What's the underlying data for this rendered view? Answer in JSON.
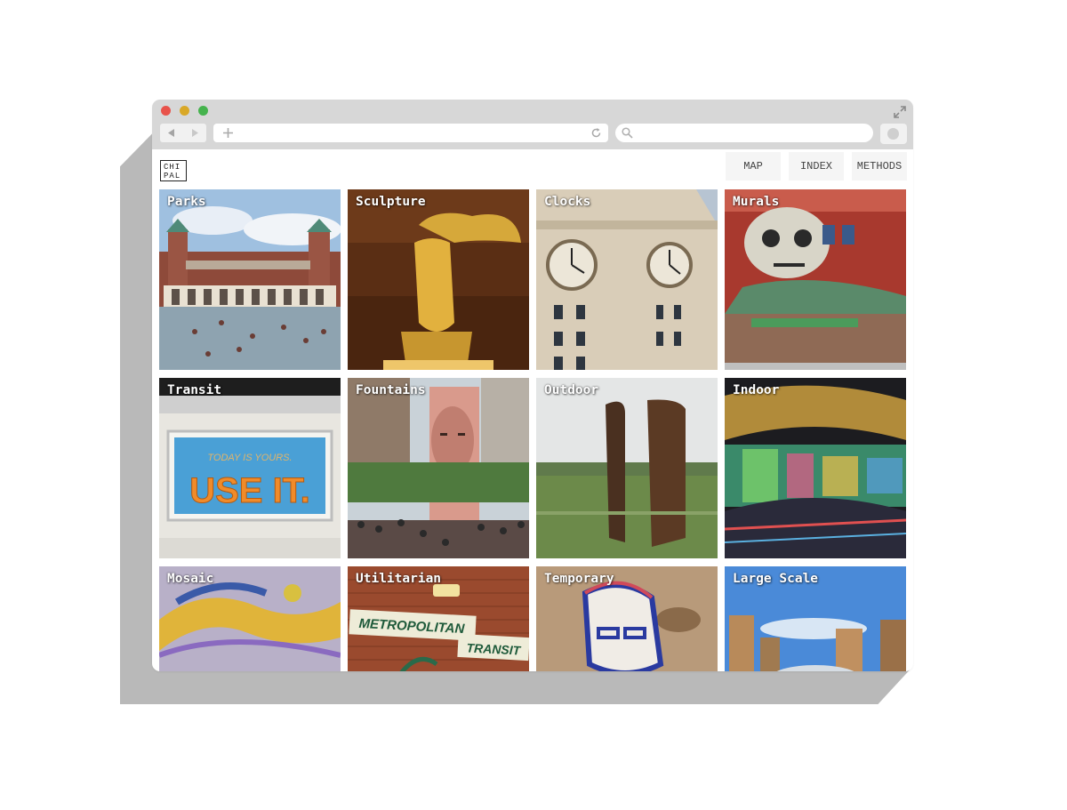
{
  "browser": {
    "url_value": "",
    "search_value": ""
  },
  "site": {
    "logo_line1": "CHI",
    "logo_line2": "PAL",
    "nav": [
      "MAP",
      "INDEX",
      "METHODS"
    ]
  },
  "categories": [
    "Parks",
    "Sculpture",
    "Clocks",
    "Murals",
    "Transit",
    "Fountains",
    "Outdoor",
    "Indoor",
    "Mosaic",
    "Utilitarian",
    "Temporary",
    "Large Scale"
  ],
  "tile_art_text": {
    "transit_line1": "TODAY IS YOURS.",
    "transit_line2": "USE IT.",
    "utilitarian_sign1": "METROPOLITAN",
    "utilitarian_sign2": "TRANSIT"
  },
  "colors": {
    "chrome_bg": "#d7d7d7",
    "close": "#e8524a",
    "minimize": "#d9a827",
    "zoom": "#45b34d"
  },
  "icons": [
    "back-arrow-icon",
    "forward-arrow-icon",
    "plus-icon",
    "reload-icon",
    "search-icon",
    "expand-icon",
    "extension-icon"
  ]
}
